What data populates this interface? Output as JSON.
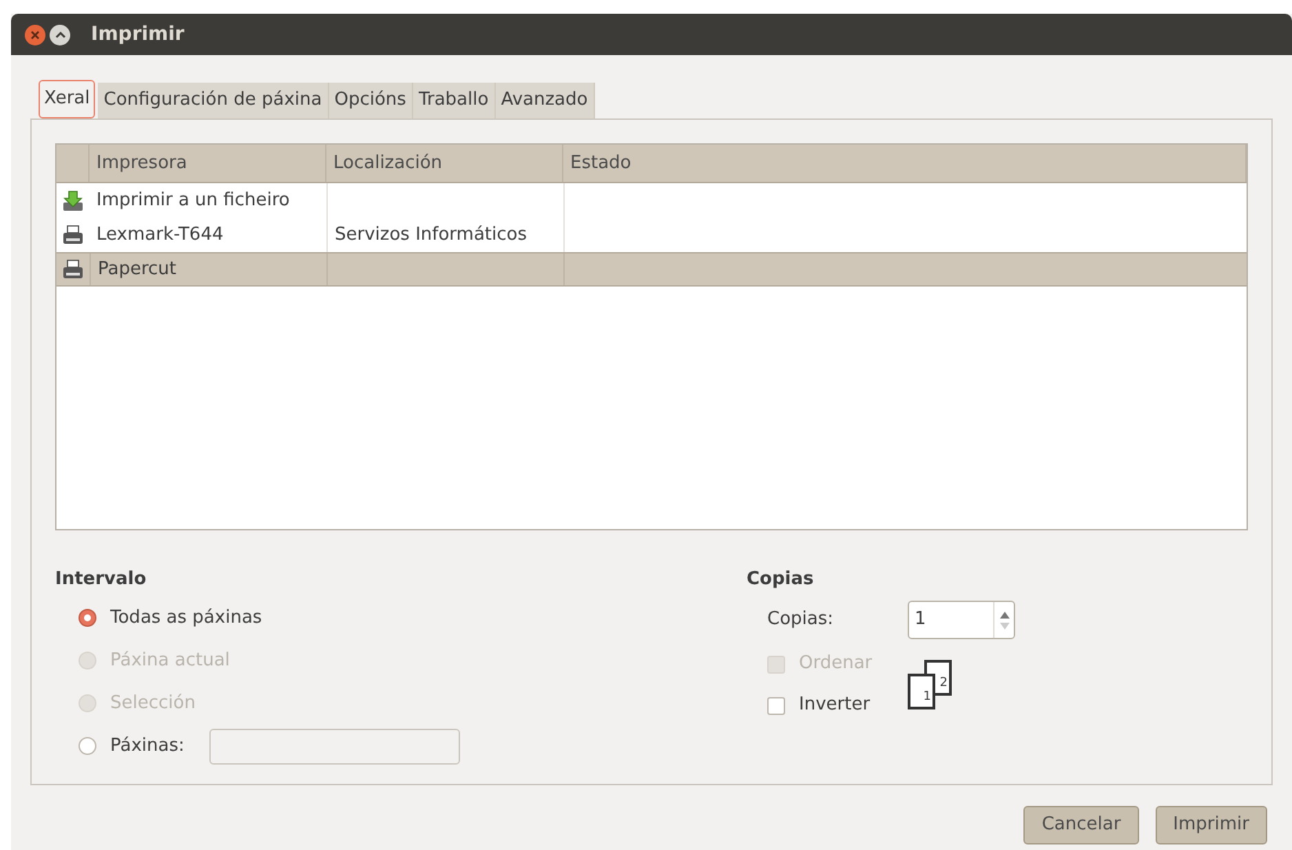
{
  "window": {
    "title": "Imprimir"
  },
  "tabs": [
    {
      "label": "Xeral",
      "selected": true
    },
    {
      "label": "Configuración de páxina",
      "selected": false
    },
    {
      "label": "Opcións",
      "selected": false
    },
    {
      "label": "Traballo",
      "selected": false
    },
    {
      "label": "Avanzado",
      "selected": false
    }
  ],
  "printers": {
    "columns": [
      "Impresora",
      "Localización",
      "Estado"
    ],
    "rows": [
      {
        "kind": "file",
        "name": "Imprimir a un ficheiro",
        "location": "",
        "selected": false
      },
      {
        "kind": "printer",
        "name": "Lexmark-T644",
        "location": "Servizos Informáticos",
        "selected": false
      },
      {
        "kind": "printer",
        "name": "Papercut",
        "location": "",
        "selected": true
      }
    ]
  },
  "range": {
    "title": "Intervalo",
    "options": [
      {
        "label": "Todas as páxinas",
        "selected": true,
        "disabled": false
      },
      {
        "label": "Páxina actual",
        "selected": false,
        "disabled": true
      },
      {
        "label": "Selección",
        "selected": false,
        "disabled": true
      },
      {
        "label": "Páxinas:",
        "selected": false,
        "disabled": false,
        "kind": "pages"
      }
    ]
  },
  "copies": {
    "title": "Copias",
    "label": "Copias:",
    "value": "1",
    "options": [
      {
        "label": "Ordenar",
        "checked": false,
        "disabled": true
      },
      {
        "label": "Inverter",
        "checked": false,
        "disabled": false
      }
    ],
    "collate_pages": [
      "1",
      "2"
    ]
  },
  "buttons": [
    {
      "label": "Cancelar"
    },
    {
      "label": "Imprimir"
    }
  ]
}
